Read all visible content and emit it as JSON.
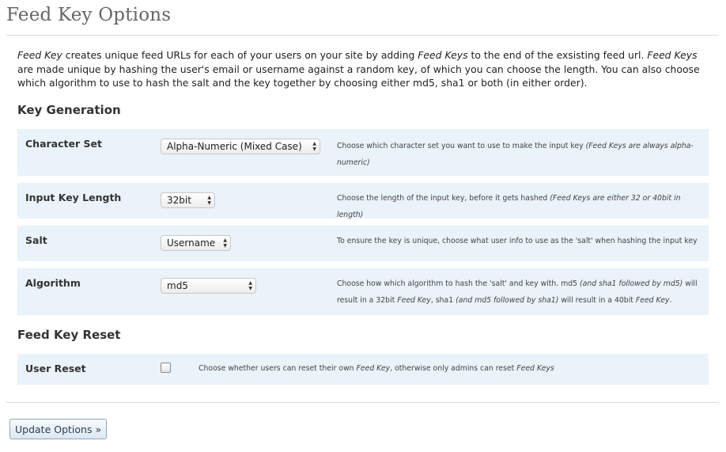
{
  "page": {
    "title": "Feed Key Options"
  },
  "intro": {
    "parts": [
      {
        "text": "Feed Key",
        "em": true
      },
      {
        "text": " creates unique feed URLs for each of your users on your site by adding ",
        "em": false
      },
      {
        "text": "Feed Keys",
        "em": true
      },
      {
        "text": " to the end of the exsisting feed url. ",
        "em": false
      },
      {
        "text": "Feed Keys",
        "em": true
      },
      {
        "text": " are made unique by hashing the user's email or username against a random key, of which you can choose the length. You can also choose which algorithm to use to hash the salt and the key together by choosing either md5, sha1 or both (in either order).",
        "em": false
      }
    ]
  },
  "key_generation": {
    "heading": "Key Generation",
    "rows": [
      {
        "label": "Character Set",
        "selected": "Alpha-Numeric (Mixed Case)",
        "help": [
          {
            "text": "Choose which character set you want to use to make the input key ",
            "em": false
          },
          {
            "text": "(Feed Keys are always alpha-numeric)",
            "em": true
          }
        ]
      },
      {
        "label": "Input Key Length",
        "selected": "32bit",
        "help": [
          {
            "text": "Choose the length of the input key, before it gets hashed ",
            "em": false
          },
          {
            "text": "(Feed Keys are either 32 or 40bit in length)",
            "em": true
          }
        ]
      },
      {
        "label": "Salt",
        "selected": "Username",
        "help": [
          {
            "text": "To ensure the key is unique, choose what user info to use as the 'salt' when hashing the input key",
            "em": false
          }
        ]
      },
      {
        "label": "Algorithm",
        "selected": "md5",
        "help": [
          {
            "text": "Choose how which algorithm to hash the 'salt' and key with. md5 ",
            "em": false
          },
          {
            "text": "(and sha1 followed by md5)",
            "em": true
          },
          {
            "text": " will result in a 32bit ",
            "em": false
          },
          {
            "text": "Feed Key",
            "em": true
          },
          {
            "text": ", sha1 ",
            "em": false
          },
          {
            "text": "(and md5 followed by sha1)",
            "em": true
          },
          {
            "text": " will result in a 40bit ",
            "em": false
          },
          {
            "text": "Feed Key",
            "em": true
          },
          {
            "text": ".",
            "em": false
          }
        ]
      }
    ]
  },
  "feed_key_reset": {
    "heading": "Feed Key Reset",
    "row": {
      "label": "User Reset",
      "checked": false,
      "help": [
        {
          "text": "Choose whether users can reset their own ",
          "em": false
        },
        {
          "text": "Feed Key",
          "em": true
        },
        {
          "text": ", otherwise only admins can reset ",
          "em": false
        },
        {
          "text": "Feed Keys",
          "em": true
        }
      ]
    }
  },
  "actions": {
    "update_label": "Update Options »"
  },
  "icons": {
    "select": "up-down-arrows-icon",
    "checkbox": "checkbox-icon"
  },
  "colors": {
    "row_background": "#eaf2fa",
    "button_border": "#8aa6c2"
  }
}
